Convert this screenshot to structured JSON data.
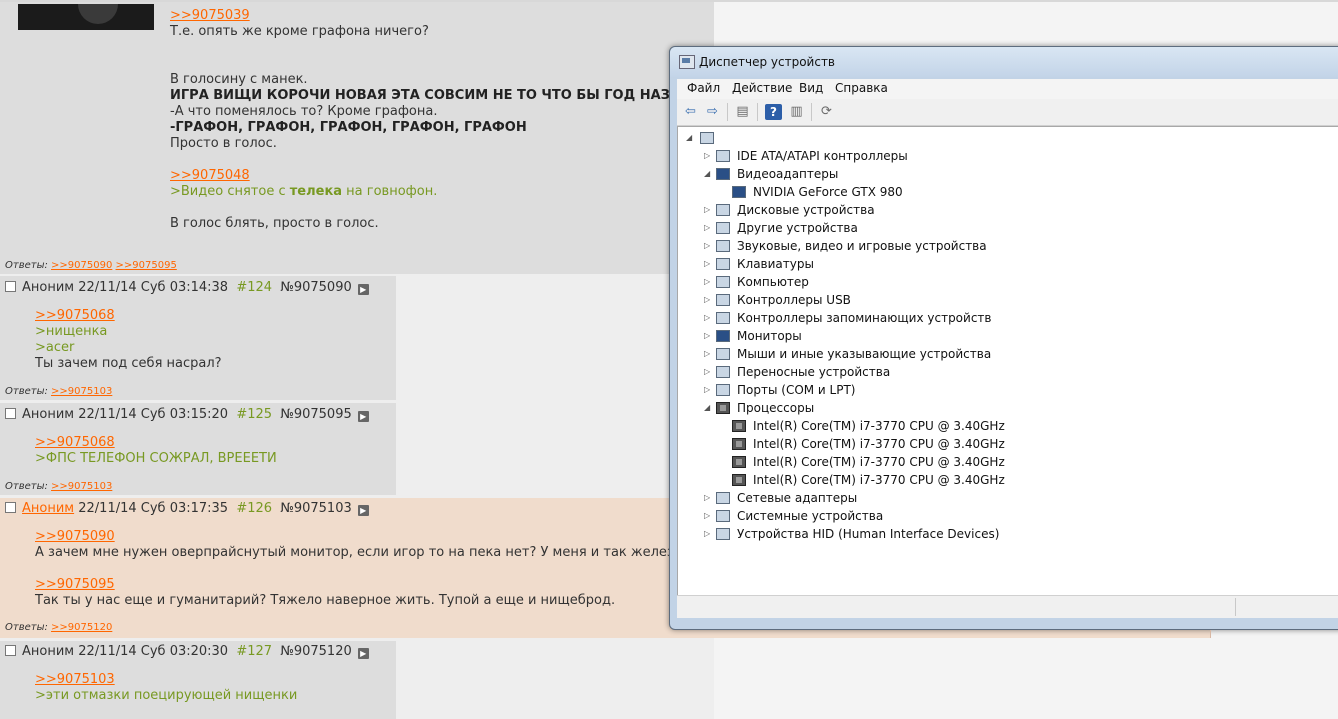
{
  "thread": {
    "first_post": {
      "lines": [
        {
          "type": "ref",
          "text": ">>9075039"
        },
        {
          "type": "text",
          "text": "Т.е. опять же кроме графона ничего?"
        },
        {
          "type": "text",
          "text": "В голосину с манек."
        },
        {
          "type": "bold",
          "text": "ИГРА ВИЩИ КОРОЧИ НОВАЯ ЭТА СОВСИМ НЕ ТО ЧТО БЫ ГОД НАЗО"
        },
        {
          "type": "text",
          "text": "-А что поменялось то? Кроме графона."
        },
        {
          "type": "bold",
          "text": "-ГРАФОН, ГРАФОН, ГРАФОН, ГРАФОН, ГРАФОН"
        },
        {
          "type": "text",
          "text": "Просто в голос."
        },
        {
          "type": "ref",
          "text": ">>9075048"
        },
        {
          "type": "quote_mixed",
          "text1": ">Видео снятое с ",
          "text2": "телека",
          "text3": " на говнофон."
        },
        {
          "type": "text",
          "text": "В голос блять, просто в голос."
        }
      ],
      "replies_label": "Ответы:",
      "replies": [
        ">>9075090",
        ">>9075095"
      ]
    },
    "posts": [
      {
        "name": "Аноним",
        "date": "22/11/14 Суб 03:14:38",
        "num": "#124",
        "id": "№9075090",
        "lines": [
          {
            "type": "ref",
            "text": ">>9075068"
          },
          {
            "type": "quote",
            "text": ">нищенка"
          },
          {
            "type": "quote",
            "text": ">acer"
          },
          {
            "type": "text",
            "text": "Ты зачем под себя насрал?"
          }
        ],
        "replies_label": "Ответы:",
        "replies": [
          ">>9075103"
        ]
      },
      {
        "name": "Аноним",
        "date": "22/11/14 Суб 03:15:20",
        "num": "#125",
        "id": "№9075095",
        "lines": [
          {
            "type": "ref",
            "text": ">>9075068"
          },
          {
            "type": "quote",
            "text": ">ФПС ТЕЛЕФОН СОЖРАЛ, ВРЕЕЕТИ"
          }
        ],
        "replies_label": "Ответы:",
        "replies": [
          ">>9075103"
        ]
      },
      {
        "name": "Аноним",
        "date": "22/11/14 Суб 03:17:35",
        "num": "#126",
        "id": "№9075103",
        "lines": [
          {
            "type": "ref",
            "text": ">>9075090"
          },
          {
            "type": "text",
            "text": "А зачем мне нужен оверпрайснутый монитор, если игор то на пека нет? У меня и так железо"
          },
          {
            "type": "ref",
            "text": ">>9075095"
          },
          {
            "type": "text",
            "text": "Так ты у нас еще и гуманитарий? Тяжело наверное жить. Тупой а еще и нищеброд."
          }
        ],
        "replies_label": "Ответы:",
        "replies": [
          ">>9075120"
        ]
      },
      {
        "name": "Аноним",
        "date": "22/11/14 Суб 03:20:30",
        "num": "#127",
        "id": "№9075120",
        "lines": [
          {
            "type": "ref",
            "text": ">>9075103"
          },
          {
            "type": "quote",
            "text": ">эти отмазки поецирующей нищенки"
          }
        ]
      }
    ]
  },
  "device_manager": {
    "title": "Диспетчер устройств",
    "menu": [
      "Файл",
      "Действие",
      "Вид",
      "Справка"
    ],
    "toolbar_icons": [
      "back-arrow-icon",
      "forward-arrow-icon",
      "properties-icon",
      "help-icon",
      "view-icon",
      "scan-hardware-icon"
    ],
    "tree": [
      {
        "label": "IDE ATA/ATAPI контроллеры",
        "level": 1,
        "expanded": false,
        "icon": "ide-controller-icon"
      },
      {
        "label": "Видеоадаптеры",
        "level": 1,
        "expanded": true,
        "icon": "display-adapter-icon"
      },
      {
        "label": "NVIDIA GeForce GTX 980",
        "level": 2,
        "icon": "display-adapter-icon"
      },
      {
        "label": "Дисковые устройства",
        "level": 1,
        "expanded": false,
        "icon": "disk-drive-icon"
      },
      {
        "label": "Другие устройства",
        "level": 1,
        "expanded": false,
        "icon": "unknown-device-icon"
      },
      {
        "label": "Звуковые, видео и игровые устройства",
        "level": 1,
        "expanded": false,
        "icon": "sound-icon"
      },
      {
        "label": "Клавиатуры",
        "level": 1,
        "expanded": false,
        "icon": "keyboard-icon"
      },
      {
        "label": "Компьютер",
        "level": 1,
        "expanded": false,
        "icon": "computer-icon"
      },
      {
        "label": "Контроллеры USB",
        "level": 1,
        "expanded": false,
        "icon": "usb-icon"
      },
      {
        "label": "Контроллеры запоминающих устройств",
        "level": 1,
        "expanded": false,
        "icon": "storage-controller-icon"
      },
      {
        "label": "Мониторы",
        "level": 1,
        "expanded": false,
        "icon": "monitor-icon"
      },
      {
        "label": "Мыши и иные указывающие устройства",
        "level": 1,
        "expanded": false,
        "icon": "mouse-icon"
      },
      {
        "label": "Переносные устройства",
        "level": 1,
        "expanded": false,
        "icon": "portable-device-icon"
      },
      {
        "label": "Порты (COM и LPT)",
        "level": 1,
        "expanded": false,
        "icon": "port-icon"
      },
      {
        "label": "Процессоры",
        "level": 1,
        "expanded": true,
        "icon": "processor-icon"
      },
      {
        "label": "Intel(R) Core(TM) i7-3770 CPU @ 3.40GHz",
        "level": 2,
        "icon": "processor-icon"
      },
      {
        "label": "Intel(R) Core(TM) i7-3770 CPU @ 3.40GHz",
        "level": 2,
        "icon": "processor-icon"
      },
      {
        "label": "Intel(R) Core(TM) i7-3770 CPU @ 3.40GHz",
        "level": 2,
        "icon": "processor-icon"
      },
      {
        "label": "Intel(R) Core(TM) i7-3770 CPU @ 3.40GHz",
        "level": 2,
        "icon": "processor-icon"
      },
      {
        "label": "Сетевые адаптеры",
        "level": 1,
        "expanded": false,
        "icon": "network-adapter-icon"
      },
      {
        "label": "Системные устройства",
        "level": 1,
        "expanded": false,
        "icon": "system-device-icon"
      },
      {
        "label": "Устройства HID (Human Interface Devices)",
        "level": 1,
        "expanded": false,
        "icon": "hid-icon"
      }
    ]
  },
  "colors": {
    "reflink": "#ff6600",
    "quote": "#789922",
    "post_bg": "#dddddd",
    "highlight_bg": "#f0dccc"
  }
}
